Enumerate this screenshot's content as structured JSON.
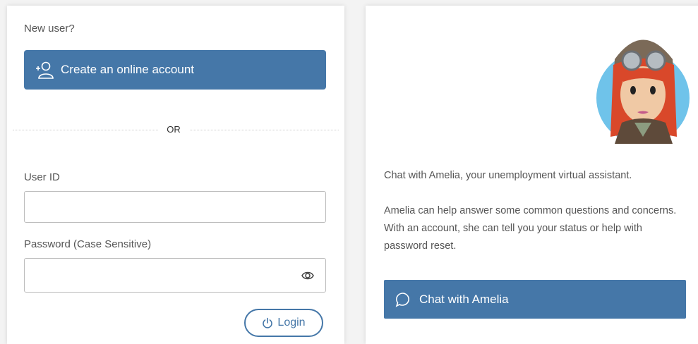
{
  "login": {
    "new_user_text": "New user?",
    "create_account_label": "Create an online account",
    "or_text": "OR",
    "user_id_label": "User ID",
    "user_id_value": "",
    "password_label": "Password (Case Sensitive)",
    "password_value": "",
    "login_label": "Login"
  },
  "chat": {
    "intro_text": "Chat with Amelia, your unemployment virtual assistant.",
    "description_text": "Amelia can help answer some common questions and concerns. With an account, she can tell you your status or help with password reset.",
    "chat_button_label": "Chat with Amelia"
  },
  "icons": {
    "create_account": "add-user-icon",
    "password_toggle": "eye-icon",
    "login": "power-icon",
    "chat": "chat-bubble-icon",
    "avatar": "amelia-avatar"
  },
  "colors": {
    "primary": "#4577a8",
    "background": "#f3f3f3",
    "panel": "#ffffff"
  }
}
